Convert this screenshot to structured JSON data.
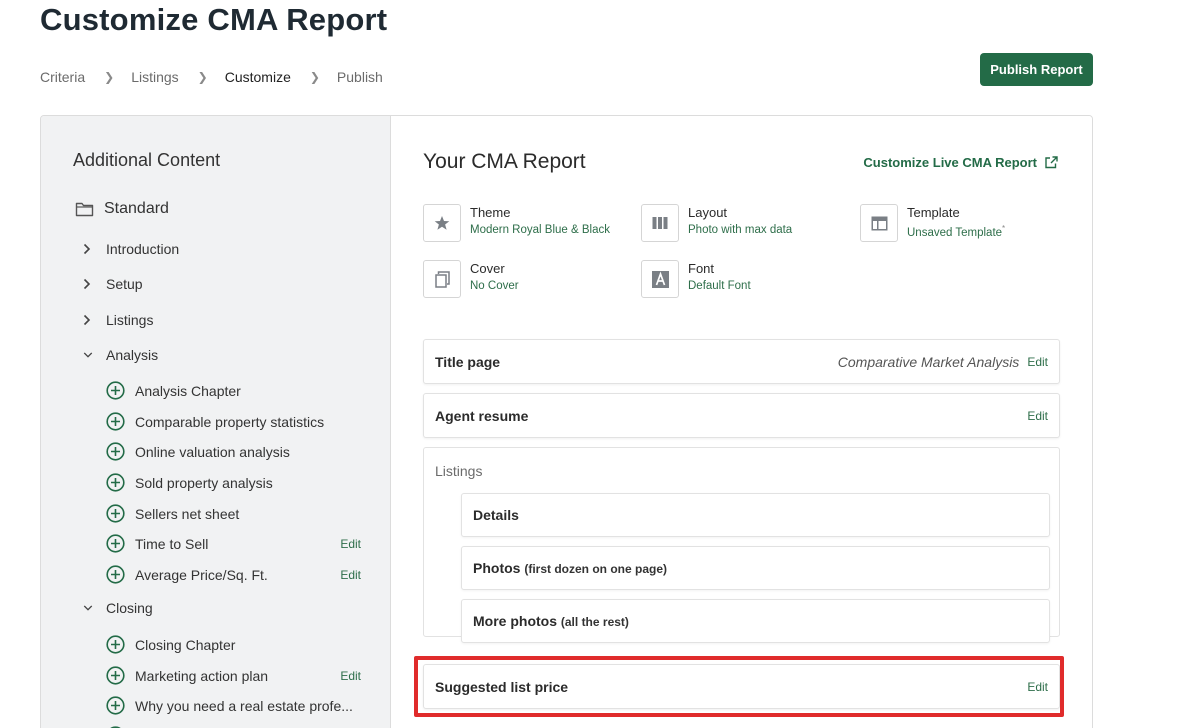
{
  "page": {
    "title": "Customize CMA Report"
  },
  "breadcrumb": [
    {
      "label": "Criteria"
    },
    {
      "label": "Listings"
    },
    {
      "label": "Customize"
    },
    {
      "label": "Publish"
    }
  ],
  "toolbar": {
    "publish_label": "Publish Report"
  },
  "sidebar": {
    "title": "Additional Content",
    "folder": "Standard",
    "sections": [
      {
        "label": "Introduction",
        "expanded": false
      },
      {
        "label": "Setup",
        "expanded": false
      },
      {
        "label": "Listings",
        "expanded": false
      },
      {
        "label": "Analysis",
        "expanded": true
      },
      {
        "label": "Closing",
        "expanded": true
      }
    ],
    "analysis_items": [
      {
        "label": "Analysis Chapter",
        "edit": ""
      },
      {
        "label": "Comparable property statistics",
        "edit": ""
      },
      {
        "label": "Online valuation analysis",
        "edit": ""
      },
      {
        "label": "Sold property analysis",
        "edit": ""
      },
      {
        "label": "Sellers net sheet",
        "edit": ""
      },
      {
        "label": "Time to Sell",
        "edit": "Edit"
      },
      {
        "label": "Average Price/Sq. Ft.",
        "edit": "Edit"
      }
    ],
    "closing_items": [
      {
        "label": "Closing Chapter",
        "edit": ""
      },
      {
        "label": "Marketing action plan",
        "edit": "Edit"
      },
      {
        "label": "Why you need a real estate profe...",
        "edit": ""
      }
    ]
  },
  "report": {
    "title": "Your CMA Report",
    "live_link": "Customize Live CMA Report",
    "options": {
      "theme": {
        "label": "Theme",
        "value": "Modern Royal Blue & Black",
        "icon": "star-icon"
      },
      "layout": {
        "label": "Layout",
        "value": "Photo with max data",
        "icon": "columns-icon"
      },
      "template": {
        "label": "Template",
        "value": "Unsaved Template",
        "marker": "*",
        "icon": "template-icon"
      },
      "cover": {
        "label": "Cover",
        "value": "No Cover",
        "icon": "copy-icon"
      },
      "font": {
        "label": "Font",
        "value": "Default Font",
        "icon": "font-icon"
      }
    },
    "pages": {
      "title_page": {
        "title": "Title page",
        "value": "Comparative Market Analysis",
        "edit": "Edit"
      },
      "agent_resume": {
        "title": "Agent resume",
        "edit": "Edit"
      },
      "listings": {
        "label": "Listings",
        "details": {
          "title": "Details",
          "note": ""
        },
        "photos": {
          "title": "Photos",
          "note": "(first dozen on one page)"
        },
        "more_photos": {
          "title": "More photos",
          "note": "(all the rest)"
        }
      },
      "suggested_price": {
        "title": "Suggested list price",
        "edit": "Edit"
      }
    }
  },
  "colors": {
    "accent": "#236b47",
    "link": "#2e6e4a",
    "highlight": "#e02b2b",
    "sidebar_bg": "#f1f2f3"
  }
}
